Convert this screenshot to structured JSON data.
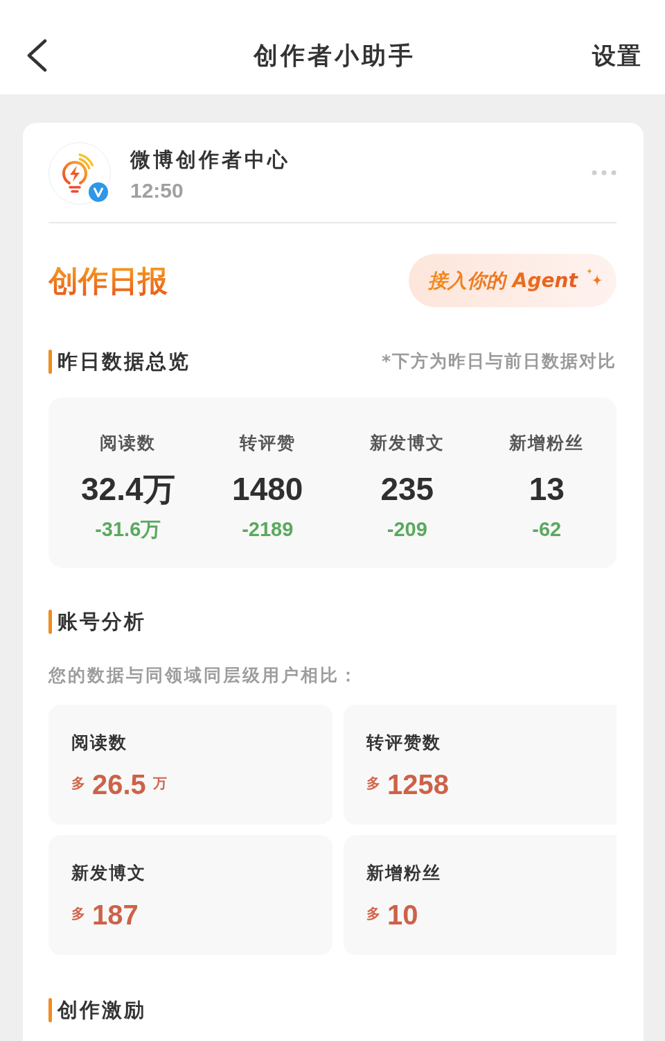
{
  "header": {
    "title": "创作者小助手",
    "action": "设置"
  },
  "post": {
    "author": "微博创作者中心",
    "time": "12:50",
    "verified": true
  },
  "report": {
    "title": "创作日报",
    "agent_button": "接入你的 Agent"
  },
  "overview": {
    "heading": "昨日数据总览",
    "note": "*下方为昨日与前日数据对比",
    "stats": [
      {
        "label": "阅读数",
        "value": "32.4万",
        "change": "-31.6万"
      },
      {
        "label": "转评赞",
        "value": "1480",
        "change": "-2189"
      },
      {
        "label": "新发博文",
        "value": "235",
        "change": "-209"
      },
      {
        "label": "新增粉丝",
        "value": "13",
        "change": "-62"
      }
    ]
  },
  "analysis": {
    "heading": "账号分析",
    "subtitle": "您的数据与同领域同层级用户相比：",
    "metrics": [
      {
        "label": "阅读数",
        "comparison": "多",
        "value": "26.5",
        "unit": "万"
      },
      {
        "label": "转评赞数",
        "comparison": "多",
        "value": "1258"
      },
      {
        "label": "新发博文",
        "comparison": "多",
        "value": "187"
      },
      {
        "label": "新增粉丝",
        "comparison": "多",
        "value": "10"
      }
    ]
  },
  "incentive": {
    "heading": "创作激励"
  }
}
